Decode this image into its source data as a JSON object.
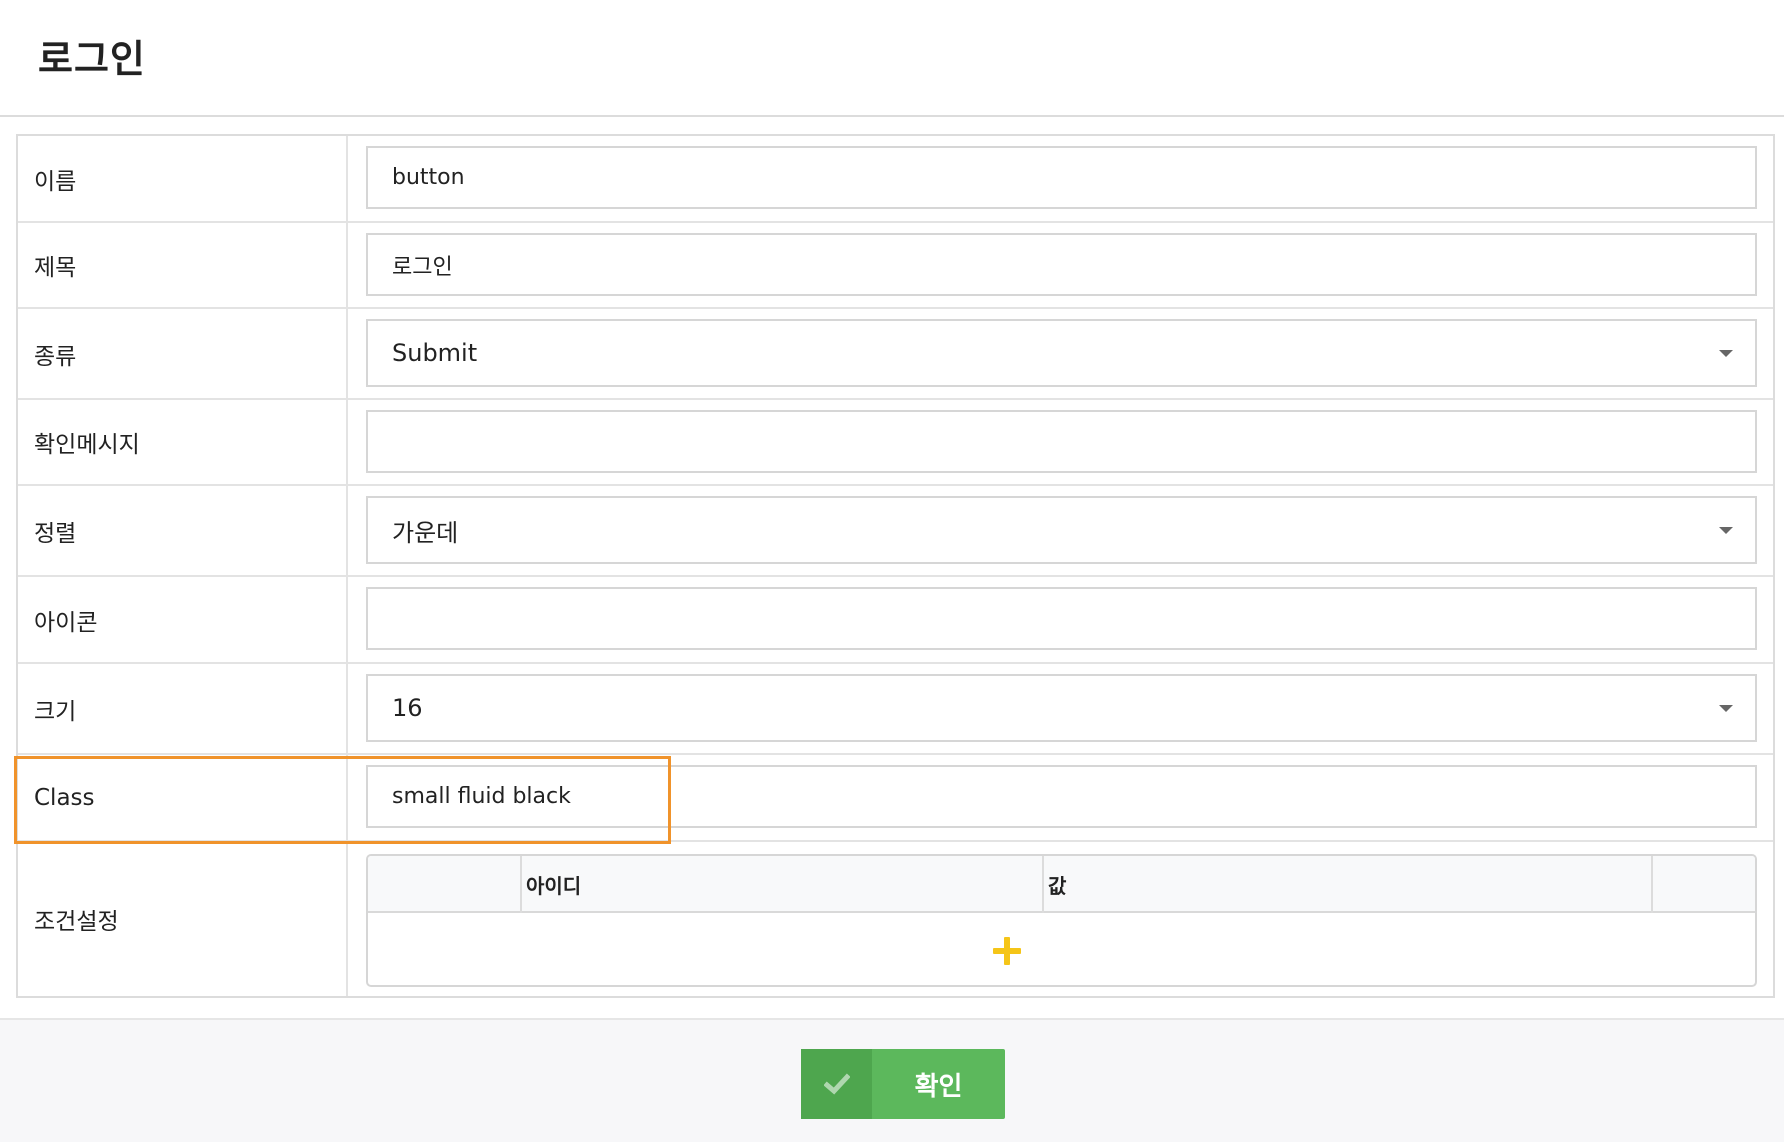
{
  "header": {
    "title": "로그인"
  },
  "fields": {
    "name": {
      "label": "이름",
      "value": "button"
    },
    "caption": {
      "label": "제목",
      "value": "로그인"
    },
    "type": {
      "label": "종류",
      "value": "Submit"
    },
    "confirm_message": {
      "label": "확인메시지",
      "value": ""
    },
    "align": {
      "label": "정렬",
      "value": "가운데"
    },
    "icon": {
      "label": "아이콘",
      "value": ""
    },
    "size": {
      "label": "크기",
      "value": "16"
    },
    "class_name": {
      "label": "Class",
      "value": "small fluid black"
    },
    "conditions": {
      "label": "조건설정",
      "columns": [
        "아이디",
        "값"
      ],
      "add_icon": "plus-icon"
    }
  },
  "footer": {
    "confirm_label": "확인",
    "confirm_icon": "check-icon"
  },
  "colors": {
    "highlight": "#f0932b",
    "confirm": "#5cb85c",
    "confirm_icon_bg": "#4ea64e",
    "add_icon": "#f5c518"
  }
}
